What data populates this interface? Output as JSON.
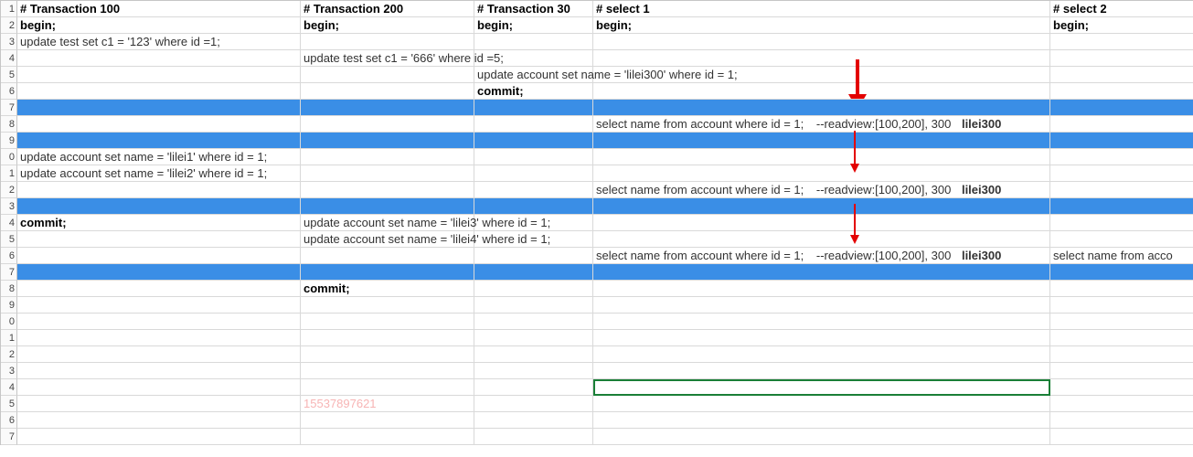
{
  "headers": {
    "colA": "# Transaction 100",
    "colB": "# Transaction 200",
    "colC": "# Transaction 30",
    "colD": "# select 1",
    "colE": "# select 2"
  },
  "begin": "begin;",
  "rows": {
    "r3a": "update test set c1 = '123' where id =1;",
    "r4b": "update test set c1 = '666' where id =5;",
    "r5c": "update account set name = 'lilei300' where id = 1;",
    "r6c": "commit;",
    "r8d_query": "select name from account where id = 1;",
    "r8d_rv": "--readview:[100,200], 300",
    "r8d_res": "lilei300",
    "r10a": "update account set name = 'lilei1' where id = 1;",
    "r11a": "update account set name = 'lilei2' where id = 1;",
    "r12d_query": "select name from account where id = 1;",
    "r12d_rv": "--readview:[100,200], 300",
    "r12d_res": "lilei300",
    "r14a": "commit;",
    "r14b": "update account set name = 'lilei3' where id = 1;",
    "r15b": "update account set name = 'lilei4' where id = 1;",
    "r16d_query": "select name from account where id = 1;",
    "r16d_rv": "--readview:[100,200], 300",
    "r16d_res": "lilei300",
    "r16e": "select name from acco",
    "r18b": "commit;"
  },
  "watermark": "15537897621"
}
